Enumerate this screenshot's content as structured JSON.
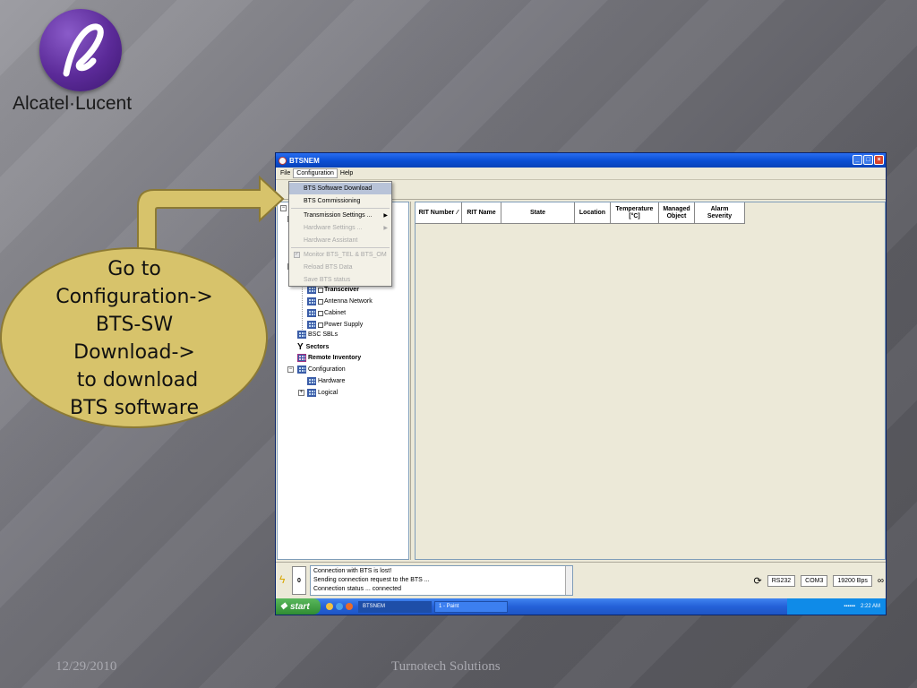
{
  "slide": {
    "logo_text": "Alcatel·Lucent",
    "callout_lines": [
      "Go to",
      "Configuration->",
      "BTS-SW",
      "Download->",
      " to download",
      "BTS software"
    ],
    "footer_date": "12/29/2010",
    "footer_center": "Turnotech Solutions"
  },
  "window": {
    "title": "BTSNEM",
    "menu": [
      "File",
      "Configuration",
      "Help"
    ],
    "dropdown": {
      "items": [
        {
          "label": "BTS Software Download",
          "state": "highlight"
        },
        {
          "label": "BTS Commissioning",
          "state": "normal"
        },
        {
          "label": "Transmission Settings ...",
          "state": "normal",
          "submenu": true
        },
        {
          "label": "Hardware Settings ...",
          "state": "disabled",
          "submenu": true
        },
        {
          "label": "Hardware Assistant",
          "state": "disabled"
        },
        {
          "label": "Monitor BTS_TEL & BTS_OM",
          "state": "disabled",
          "checked": true
        },
        {
          "label": "Reload BTS Data",
          "state": "disabled"
        },
        {
          "label": "Save BTS status",
          "state": "disabled"
        }
      ]
    },
    "tree": [
      {
        "label": "Transceiver",
        "checkbox": true
      },
      {
        "label": "Antenna Network",
        "checkbox": true
      },
      {
        "label": "Cabinet",
        "checkbox": true
      },
      {
        "label": "Power Supply",
        "checkbox": true
      },
      {
        "label": "BSC SBLs"
      },
      {
        "label": "Sectors"
      },
      {
        "label": "Remote Inventory"
      },
      {
        "label": "Configuration"
      },
      {
        "label": "Hardware"
      },
      {
        "label": "Logical"
      }
    ],
    "columns": [
      "RIT Number",
      "RIT Name",
      "State",
      "Location",
      "Temperature [°C]",
      "Managed Object",
      "Alarm Severity"
    ],
    "status": {
      "counter": "0",
      "log": [
        "Connection with BTS is lost!",
        "Sending connection request to the BTS ...",
        "Connection status ... connected"
      ],
      "port": "RS232",
      "com": "COM3",
      "baud": "19200 Bps"
    },
    "taskbar": {
      "start": "start",
      "tasks": [
        "BTSNEM",
        "1 - Paint"
      ],
      "clock": "2:22 AM"
    }
  },
  "colors": {
    "callout_fill": "#d7c36b",
    "title_bar": "#0b50d6",
    "logo_purple": "#5b2a98"
  }
}
